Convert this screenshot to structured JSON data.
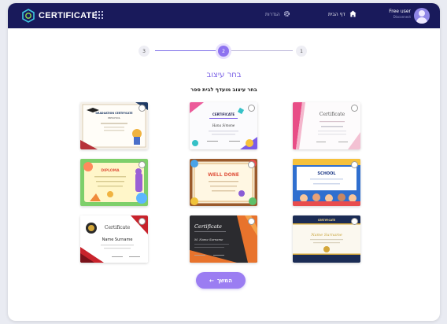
{
  "header": {
    "logo_text": "CERTIFICATE",
    "settings_label": "הגדרות",
    "home_label": "דף הבית",
    "user_name": "Free user",
    "user_status": "Disconnect"
  },
  "stepper": {
    "steps": [
      {
        "label": "3",
        "active": false
      },
      {
        "label": "2",
        "active": true
      },
      {
        "label": "1",
        "active": false
      }
    ]
  },
  "main": {
    "title": "בחר עיצוב",
    "subtitle": "בחר עיצוב מועדף לבית ספר"
  },
  "templates": [
    {
      "id": "graduation",
      "heading": "GRADUATION CERTIFICATE",
      "subheading": "PRESCHOOL"
    },
    {
      "id": "certificate-colorful",
      "heading": "CERTIFICATE",
      "name": "Hana Simone"
    },
    {
      "id": "certificate-pink",
      "heading": "Certificate"
    },
    {
      "id": "diploma-kids",
      "heading": "DIPLOMA"
    },
    {
      "id": "well-done",
      "heading": "WELL DONE"
    },
    {
      "id": "school-kids",
      "heading": "SCHOOL"
    },
    {
      "id": "certificate-red",
      "heading": "Certificate",
      "name": "Name Surname"
    },
    {
      "id": "certificate-dark",
      "heading": "Certificate",
      "name": "M. Name Surname"
    },
    {
      "id": "certificate-navy",
      "heading": "CERTIFICATE",
      "name": "Name Surname"
    }
  ],
  "footer": {
    "continue_label": "המשך",
    "continue_arrow": "←"
  },
  "colors": {
    "topbar": "#191a5b",
    "accent": "#8e73f0",
    "button": "#9b7df2"
  }
}
